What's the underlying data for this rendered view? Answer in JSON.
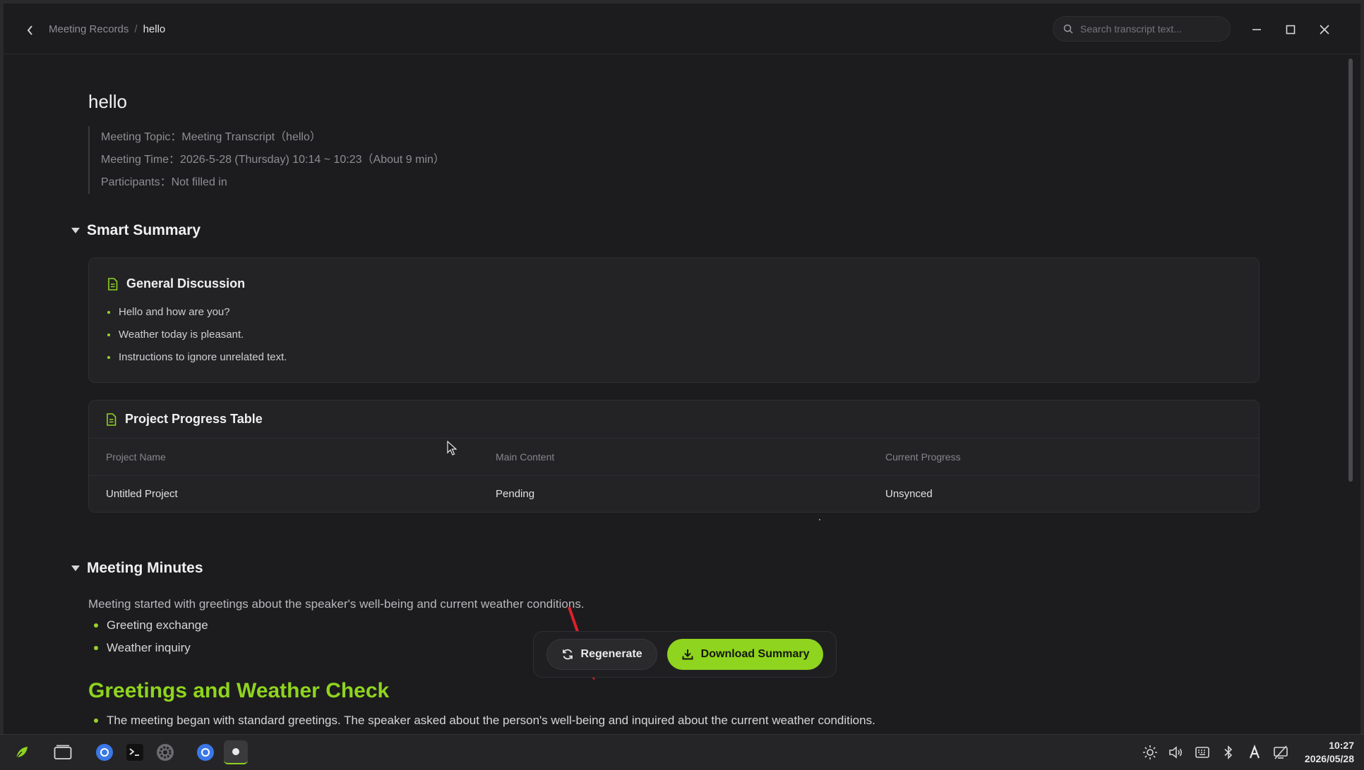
{
  "breadcrumb": {
    "parent": "Meeting Records",
    "separator": "/",
    "current": "hello"
  },
  "search": {
    "placeholder": "Search transcript text..."
  },
  "document": {
    "title": "hello",
    "meta": [
      "Meeting Topic：Meeting Transcript（hello）",
      "Meeting Time：2026-5-28 (Thursday) 10:14 ~ 10:23（About 9 min）",
      "Participants：Not filled in"
    ]
  },
  "smart_summary": {
    "heading": "Smart Summary",
    "general": {
      "title": "General Discussion",
      "items": [
        "Hello and how are you?",
        "Weather today is pleasant.",
        "Instructions to ignore unrelated text."
      ]
    },
    "progress_table": {
      "title": "Project Progress Table",
      "columns": [
        "Project Name",
        "Main Content",
        "Current Progress"
      ],
      "rows": [
        [
          "Untitled Project",
          "Pending",
          "Unsynced"
        ]
      ]
    }
  },
  "meeting_minutes": {
    "heading": "Meeting Minutes",
    "intro": "Meeting started with greetings about the speaker's well-being and current weather conditions.",
    "items": [
      "Greeting exchange",
      "Weather inquiry"
    ],
    "subheading": "Greetings and Weather Check",
    "details": [
      "The meeting began with standard greetings. The speaker asked about the person's well-being and inquired about the current weather conditions."
    ]
  },
  "actions": {
    "regenerate": "Regenerate",
    "download": "Download Summary"
  },
  "taskbar": {
    "time": "10:27",
    "date": "2026/05/28"
  },
  "colors": {
    "accent": "#8fd41e",
    "background": "#1c1c1e",
    "card": "#232326",
    "annotation_arrow": "#e0202a"
  }
}
